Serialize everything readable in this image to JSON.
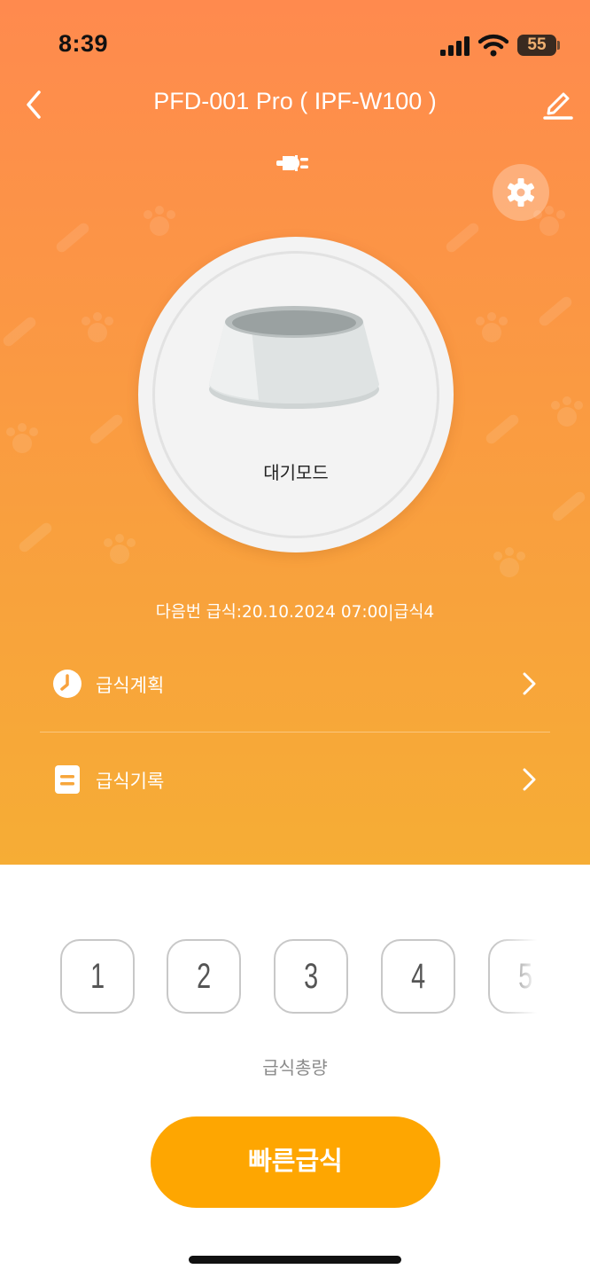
{
  "status_bar": {
    "time": "8:39",
    "battery": "55"
  },
  "header": {
    "title": "PFD-001 Pro ( IPF-W100 )"
  },
  "device": {
    "mode": "대기모드"
  },
  "schedule": {
    "next_feed": "다음번 급식:20.10.2024 07:00|급식4"
  },
  "menu": {
    "items": [
      {
        "label": "급식계획",
        "icon": "clock-icon"
      },
      {
        "label": "급식기록",
        "icon": "list-icon"
      }
    ]
  },
  "portions": {
    "options": [
      "1",
      "2",
      "3",
      "4",
      "5"
    ]
  },
  "total_label": "급식총량",
  "quick_feed_label": "빠른급식",
  "colors": {
    "gradient_top": "#ff8a4e",
    "gradient_bottom": "#f6ad35",
    "accent": "#fea601"
  }
}
